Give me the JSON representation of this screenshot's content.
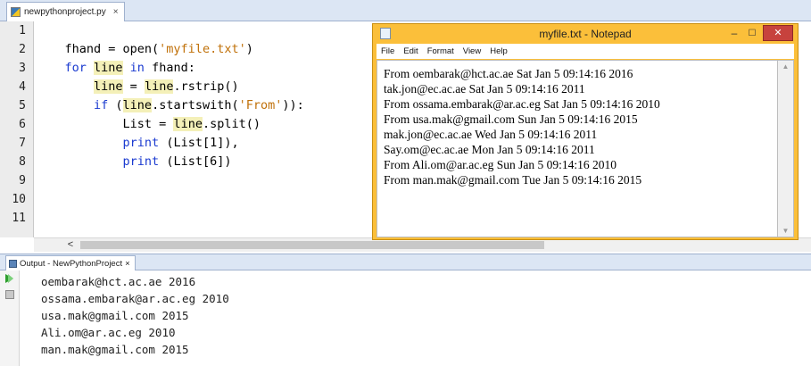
{
  "editor": {
    "tab_label": "newpythonproject.py",
    "tab_close": "×",
    "line_numbers": [
      "1",
      "2",
      "3",
      "4",
      "5",
      "6",
      "7",
      "8",
      "9",
      "10",
      "11"
    ],
    "code": {
      "l2_fhand": "    fhand = open(",
      "l2_str": "'myfile.txt'",
      "l2_end": ")",
      "l3_for": "    for ",
      "l3_line": "line",
      "l3_in": " in ",
      "l3_end": "fhand:",
      "l4_indent": "        ",
      "l4_line": "line",
      "l4_eq": " = ",
      "l4_line2": "line",
      "l4_end": ".rstrip()",
      "l5_if": "        if ",
      "l5_paren": "(",
      "l5_line": "line",
      "l5_mid": ".startswith(",
      "l5_str": "'From'",
      "l5_end": ")):",
      "l6_start": "            List = ",
      "l6_line": "line",
      "l6_end": ".split()",
      "l7_indent": "            ",
      "l7_print": "print",
      "l7_end": " (List[1]),",
      "l8_indent": "            ",
      "l8_print": "print",
      "l8_end": " (List[6])"
    },
    "scroll_left_arrow": "<"
  },
  "notepad": {
    "title": "myfile.txt - Notepad",
    "min_glyph": "–",
    "max_glyph": "☐",
    "close_glyph": "✕",
    "menu": [
      "File",
      "Edit",
      "Format",
      "View",
      "Help"
    ],
    "lines": [
      "From oembarak@hct.ac.ae Sat Jan 5 09:14:16 2016",
      "tak.jon@ec.ac.ae Sat Jan 5 09:14:16 2011",
      "From ossama.embarak@ar.ac.eg Sat Jan 5 09:14:16 2010",
      "From usa.mak@gmail.com Sun Jan 5 09:14:16 2015",
      "mak.jon@ec.ac.ae Wed Jan 5 09:14:16 2011",
      "Say.om@ec.ac.ae Mon Jan 5 09:14:16 2011",
      "From Ali.om@ar.ac.eg Sun Jan 5 09:14:16 2010",
      "From man.mak@gmail.com Tue Jan 5 09:14:16 2015"
    ],
    "scroll_up_glyph": "▲",
    "scroll_down_glyph": "▼"
  },
  "output": {
    "tab_label": "Output - NewPythonProject",
    "tab_close": "×",
    "lines": [
      "oembarak@hct.ac.ae 2016",
      "ossama.embarak@ar.ac.eg 2010",
      "usa.mak@gmail.com 2015",
      "Ali.om@ar.ac.eg 2010",
      "man.mak@gmail.com 2015"
    ]
  },
  "colors": {
    "keyword": "#1a3ad0",
    "string": "#c07008",
    "highlight": "#f4f0b8",
    "notepad_frame": "#fbbf3a",
    "close_button": "#c7423d"
  }
}
